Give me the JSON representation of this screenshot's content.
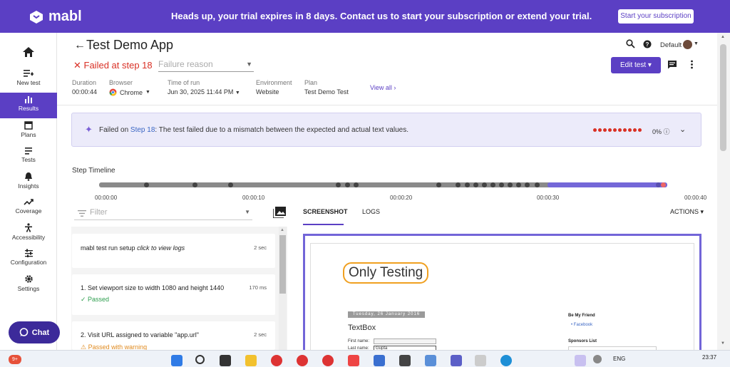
{
  "banner": {
    "logo_text": "mabl",
    "message": "Heads up, your trial expires in 8 days. Contact us to start your subscription or extend your trial.",
    "subscription_button": "Start your subscription",
    "color": "#5b3fc4"
  },
  "sidebar": {
    "items": [
      {
        "label": "",
        "icon": "home-icon"
      },
      {
        "label": "New test",
        "icon": "add-list-icon"
      },
      {
        "label": "Results",
        "icon": "bar-chart-icon",
        "active": true
      },
      {
        "label": "Plans",
        "icon": "calendar-icon"
      },
      {
        "label": "Tests",
        "icon": "list-icon"
      },
      {
        "label": "Insights",
        "icon": "bell-icon"
      },
      {
        "label": "Coverage",
        "icon": "trend-icon"
      },
      {
        "label": "Accessibility",
        "icon": "accessibility-icon"
      },
      {
        "label": "Configuration",
        "icon": "sliders-icon"
      },
      {
        "label": "Settings",
        "icon": "gear-icon"
      }
    ]
  },
  "header": {
    "title": "Test Demo App",
    "failed_text": "Failed at step 18",
    "failure_reason_placeholder": "Failure reason",
    "workspace": "Default",
    "edit_button": "Edit test",
    "meta": {
      "duration_label": "Duration",
      "duration": "00:00:44",
      "browser_label": "Browser",
      "browser": "Chrome",
      "time_label": "Time of run",
      "time": "Jun 30, 2025 11:44 PM",
      "env_label": "Environment",
      "env": "Website",
      "plan_label": "Plan",
      "plan": "Test Demo Test",
      "view_all": "View all"
    }
  },
  "callout": {
    "prefix": "Failed on ",
    "step": "Step 18",
    "message": ": The test failed due to a mismatch between the expected and actual text values.",
    "percent": "0%"
  },
  "timeline": {
    "label": "Step Timeline",
    "ticks": [
      "00:00:00",
      "00:00:10",
      "00:00:20",
      "00:00:30",
      "00:00:40"
    ]
  },
  "filter": {
    "placeholder": "Filter"
  },
  "steps": [
    {
      "title": "mabl test run setup",
      "title_suffix": "click to view logs",
      "time": "2 sec",
      "status": ""
    },
    {
      "title": "1. Set viewport size to width 1080 and height 1440",
      "time": "170 ms",
      "status": "Passed"
    },
    {
      "title": "2. Visit URL assigned to variable \"app.url\"",
      "time": "2 sec",
      "status": "Passed with warning"
    }
  ],
  "tabs": {
    "screenshot": "SCREENSHOT",
    "logs": "LOGS",
    "actions": "ACTIONS"
  },
  "screenshot": {
    "heading": "Only Testing",
    "date": "Tuesday, 26 January 2016",
    "textbox_heading": "TextBox",
    "first_name_label": "First name:",
    "last_name_label": "Last name:",
    "last_name_value": "Gupta",
    "be_my_friend": "Be My Friend",
    "facebook": "Facebook",
    "sponsors": "Sponsors List"
  },
  "chat": {
    "label": "Chat"
  },
  "taskbar": {
    "badge": "9+",
    "lang": "ENG",
    "time": "23:37"
  }
}
